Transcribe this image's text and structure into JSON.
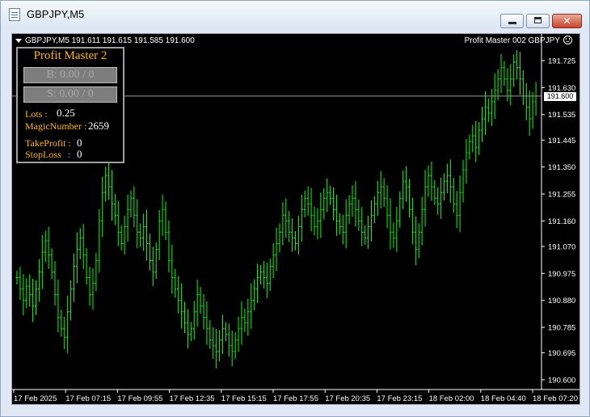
{
  "window": {
    "title": "GBPJPY,M5"
  },
  "chart": {
    "header": "GBPJPY,M5  191.611 191.615 191.585 191.600",
    "expert_label": "Profit Master 002 GBPJPY",
    "current_price": "191.600"
  },
  "panel": {
    "title": "Profit Master 2",
    "buy_button": "B: 0.00  /  0",
    "sell_button": "S: 0.00  /  0",
    "lots_label": "Lots :",
    "lots_value": "0.25",
    "magic_label": "MagicNumber :",
    "magic_value": "2659",
    "tp_label": "TakeProfit :",
    "tp_value": "0",
    "sl_label": "StopLoss",
    "sl_colon": ":",
    "sl_value": "0"
  },
  "chart_data": {
    "type": "bar",
    "title": "GBPJPY,M5",
    "y_ticks": [
      "191.725",
      "191.630",
      "191.535",
      "191.445",
      "191.350",
      "191.255",
      "191.160",
      "191.070",
      "190.975",
      "190.880",
      "190.785",
      "190.695",
      "190.600"
    ],
    "x_ticks": [
      "17 Feb 2025",
      "17 Feb 07:15",
      "17 Feb 09:55",
      "17 Feb 12:35",
      "17 Feb 15:15",
      "17 Feb 17:55",
      "17 Feb 20:35",
      "17 Feb 23:15",
      "18 Feb 02:00",
      "18 Feb 04:40",
      "18 Feb 07:20"
    ],
    "ylim": [
      190.6,
      191.77
    ],
    "series_color": "#00ff00",
    "close": [
      190.96,
      190.92,
      190.88,
      190.93,
      190.9,
      190.86,
      190.92,
      190.98,
      191.05,
      191.09,
      191.04,
      190.98,
      190.9,
      190.82,
      190.78,
      190.75,
      190.84,
      190.92,
      191.0,
      191.06,
      191.1,
      191.04,
      190.96,
      190.9,
      190.94,
      191.02,
      191.16,
      191.26,
      191.32,
      191.28,
      191.22,
      191.18,
      191.12,
      191.08,
      191.14,
      191.2,
      191.24,
      191.18,
      191.12,
      191.1,
      191.14,
      191.08,
      191.02,
      190.98,
      191.06,
      191.16,
      191.2,
      191.12,
      191.02,
      190.96,
      190.92,
      190.88,
      190.84,
      190.8,
      190.76,
      190.78,
      190.84,
      190.9,
      190.86,
      190.82,
      190.78,
      190.74,
      190.72,
      190.7,
      190.74,
      190.78,
      190.76,
      190.72,
      190.7,
      190.74,
      190.78,
      190.82,
      190.8,
      190.84,
      190.88,
      190.92,
      190.96,
      190.98,
      190.96,
      190.94,
      191.0,
      191.04,
      191.08,
      191.12,
      191.18,
      191.16,
      191.12,
      191.1,
      191.08,
      191.14,
      191.2,
      191.24,
      191.22,
      191.18,
      191.14,
      191.16,
      191.2,
      191.24,
      191.26,
      191.24,
      191.2,
      191.16,
      191.14,
      191.12,
      191.18,
      191.22,
      191.24,
      191.2,
      191.16,
      191.12,
      191.1,
      191.14,
      191.18,
      191.22,
      191.26,
      191.28,
      191.24,
      191.18,
      191.12,
      191.1,
      191.16,
      191.24,
      191.3,
      191.28,
      191.2,
      191.12,
      191.06,
      191.12,
      191.2,
      191.28,
      191.32,
      191.28,
      191.24,
      191.22,
      191.26,
      191.3,
      191.32,
      191.28,
      191.22,
      191.18,
      191.26,
      191.34,
      191.4,
      191.44,
      191.46,
      191.42,
      191.48,
      191.52,
      191.56,
      191.54,
      191.58,
      191.62,
      191.66,
      191.7,
      191.66,
      191.62,
      191.66,
      191.72,
      191.7,
      191.66,
      191.6,
      191.56,
      191.52,
      191.58,
      191.6
    ]
  }
}
